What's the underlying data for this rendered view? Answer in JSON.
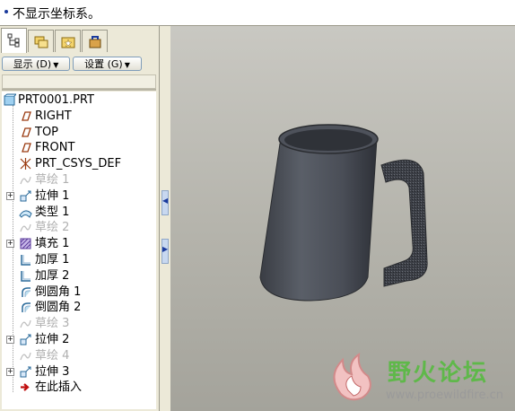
{
  "message_bar": {
    "text": "不显示坐标系。"
  },
  "toolbar": {
    "display_label": "显示 (D)",
    "settings_label": "设置 (G)"
  },
  "model_tree": {
    "items": [
      {
        "label": "PRT0001.PRT",
        "icon": "part-icon",
        "expandable": false,
        "dim": false
      },
      {
        "label": "RIGHT",
        "icon": "datum-plane-icon",
        "expandable": false,
        "dim": false
      },
      {
        "label": "TOP",
        "icon": "datum-plane-icon",
        "expandable": false,
        "dim": false
      },
      {
        "label": "FRONT",
        "icon": "datum-plane-icon",
        "expandable": false,
        "dim": false
      },
      {
        "label": "PRT_CSYS_DEF",
        "icon": "coordinate-system-icon",
        "expandable": false,
        "dim": false
      },
      {
        "label": "草绘 1",
        "icon": "sketch-icon",
        "expandable": false,
        "dim": true
      },
      {
        "label": "拉伸 1",
        "icon": "extrude-icon",
        "expandable": true,
        "dim": false
      },
      {
        "label": "类型 1",
        "icon": "style-surface-icon",
        "expandable": false,
        "dim": false
      },
      {
        "label": "草绘 2",
        "icon": "sketch-icon",
        "expandable": false,
        "dim": true
      },
      {
        "label": "填充 1",
        "icon": "fill-icon",
        "expandable": true,
        "dim": false
      },
      {
        "label": "加厚 1",
        "icon": "thicken-icon",
        "expandable": false,
        "dim": false
      },
      {
        "label": "加厚 2",
        "icon": "thicken-icon",
        "expandable": false,
        "dim": false
      },
      {
        "label": "倒圆角 1",
        "icon": "round-icon",
        "expandable": false,
        "dim": false
      },
      {
        "label": "倒圆角 2",
        "icon": "round-icon",
        "expandable": false,
        "dim": false
      },
      {
        "label": "草绘 3",
        "icon": "sketch-icon",
        "expandable": false,
        "dim": true
      },
      {
        "label": "拉伸 2",
        "icon": "extrude-icon",
        "expandable": true,
        "dim": false
      },
      {
        "label": "草绘 4",
        "icon": "sketch-icon",
        "expandable": false,
        "dim": true
      },
      {
        "label": "拉伸 3",
        "icon": "extrude-icon",
        "expandable": true,
        "dim": false
      },
      {
        "label": "在此插入",
        "icon": "insert-here-arrow-icon",
        "expandable": false,
        "dim": false
      }
    ]
  },
  "watermark": {
    "title": "野火论坛",
    "url": "www.proewildfire.cn"
  },
  "colors": {
    "tree_background": "#ffffff",
    "viewport_background": "#b4b3ab",
    "mug": "#4c5058",
    "watermark_green": "#5fb84a"
  }
}
